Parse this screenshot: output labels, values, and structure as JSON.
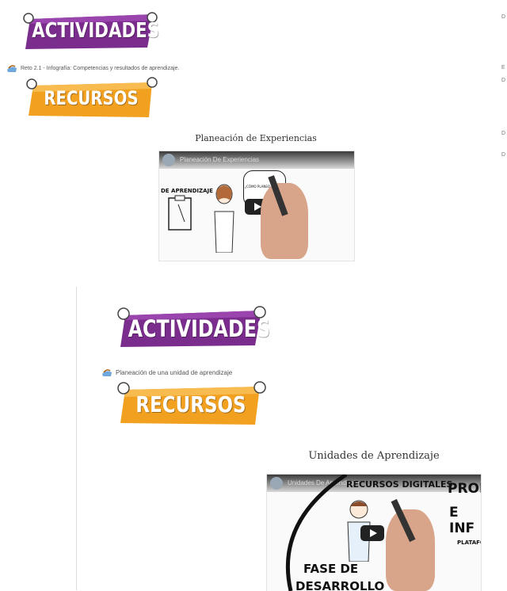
{
  "section1": {
    "actividades": "ACTIVIDADES",
    "link": "Reto 2.1 - Infografía: Competencias y resultados de aprendizaje.",
    "recursos": "RECURSOS",
    "video_title": "Planeación de Experiencias",
    "video_bar_title": "Planeación De Experiencias",
    "sketch_text_1": "DE APRENDIZAJE",
    "sketch_text_2": "¿CÓMO PLANEO MI AGENDA?"
  },
  "section2": {
    "actividades": "ACTIVIDADES",
    "link": "Planeación de una unidad de aprendizaje",
    "recursos": "RECURSOS",
    "video_title": "Unidades de Aprendizaje",
    "video_bar_title": "Unidades De Aprendizaje",
    "sketch_text_1": "RECURSOS DIGITALES",
    "sketch_text_2": "PROP",
    "sketch_text_3": "E INF",
    "sketch_text_4": "FASE DE",
    "sketch_text_5": "DESARROLLO",
    "sketch_text_6": "PLATAFO"
  },
  "right_marks": [
    "D",
    "E",
    "D",
    "D",
    "D"
  ],
  "colors": {
    "purple": "#7b2d8e",
    "orange": "#f2a020"
  },
  "icons": {
    "link_icon": "activity-icon",
    "play": "play-icon"
  }
}
